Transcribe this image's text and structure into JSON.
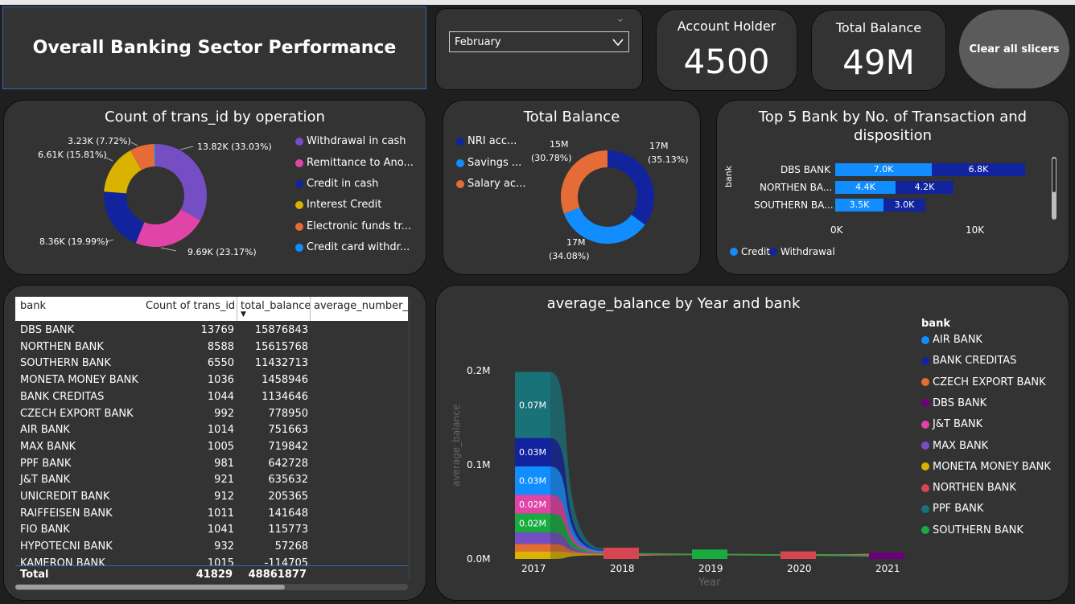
{
  "header": {
    "title": "Overall Banking Sector Performance"
  },
  "slicer": {
    "value": "February"
  },
  "kpi": {
    "account_holder_label": "Account Holder",
    "account_holder_value": "4500",
    "total_balance_label": "Total Balance",
    "total_balance_value": "49M"
  },
  "clear_button": {
    "label": "Clear all slicers"
  },
  "colors": {
    "panel": "#333333",
    "blue": "#118dff",
    "navy": "#12239e",
    "orange": "#e66c37",
    "purple": "#744ec2",
    "pink": "#e044a7",
    "yellow": "#d9b300",
    "teal": "#197278",
    "dark_purple": "#6b007b",
    "red": "#d64550",
    "green": "#1aab40"
  },
  "donut_operation": {
    "title": "Count of trans_id by operation",
    "legend": [
      "Withdrawal in cash",
      "Remittance to Ano...",
      "Credit in cash",
      "Interest Credit",
      "Electronic funds tr...",
      "Credit card withdr..."
    ],
    "labels": {
      "withdrawal": "13.82K (33.03%)",
      "remittance": "9.69K (23.17%)",
      "credit_cash": "8.36K (19.99%)",
      "interest": "6.61K (15.81%)",
      "electronic": "3.23K (7.72%)"
    }
  },
  "donut_balance": {
    "title": "Total Balance",
    "legend": [
      "NRI acc...",
      "Savings ...",
      "Salary ac..."
    ],
    "labels": {
      "nri_value": "17M",
      "nri_pct": "(35.13%)",
      "savings_value": "17M",
      "savings_pct": "(34.08%)",
      "salary_value": "15M",
      "salary_pct": "(30.78%)"
    }
  },
  "top5": {
    "title_line1": "Top 5 Bank by No. of Transaction and",
    "title_line2": "disposition",
    "axis_label": "bank",
    "banks": [
      "DBS BANK",
      "NORTHEN BA...",
      "SOUTHERN BA..."
    ],
    "credit_labels": [
      "7.0K",
      "4.4K",
      "3.5K"
    ],
    "withdrawal_labels": [
      "6.8K",
      "4.2K",
      "3.0K"
    ],
    "ticks": [
      "0K",
      "10K"
    ],
    "legend": [
      "Credit",
      "Withdrawal"
    ]
  },
  "table": {
    "headers": [
      "bank",
      "Count of trans_id",
      "total_balance",
      "average_number_o"
    ],
    "rows": [
      [
        "DBS BANK",
        "13769",
        "15876843"
      ],
      [
        "NORTHEN BANK",
        "8588",
        "15615768"
      ],
      [
        "SOUTHERN BANK",
        "6550",
        "11432713"
      ],
      [
        "MONETA MONEY BANK",
        "1036",
        "1458946"
      ],
      [
        "BANK CREDITAS",
        "1044",
        "1134646"
      ],
      [
        "CZECH EXPORT BANK",
        "992",
        "778950"
      ],
      [
        "AIR BANK",
        "1014",
        "751663"
      ],
      [
        "MAX BANK",
        "1005",
        "719842"
      ],
      [
        "PPF BANK",
        "981",
        "642728"
      ],
      [
        "J&T BANK",
        "921",
        "635632"
      ],
      [
        "UNICREDIT BANK",
        "912",
        "205365"
      ],
      [
        "RAIFFEISEN BANK",
        "1011",
        "141648"
      ],
      [
        "FIO BANK",
        "1041",
        "115773"
      ],
      [
        "HYPOTECNI BANK",
        "932",
        "57268"
      ],
      [
        "KAMERON BANK",
        "1015",
        "-114705"
      ]
    ],
    "total": [
      "Total",
      "41829",
      "48861877"
    ]
  },
  "ribbon": {
    "title": "average_balance by Year and bank",
    "xlabel": "Year",
    "ylabel": "average_balance",
    "yticks": [
      "0.2M",
      "0.1M",
      "0.0M"
    ],
    "years": [
      "2017",
      "2018",
      "2019",
      "2020",
      "2021"
    ],
    "legend_title": "bank",
    "legend": [
      "AIR BANK",
      "BANK CREDITAS",
      "CZECH EXPORT BANK",
      "DBS BANK",
      "J&T BANK",
      "MAX BANK",
      "MONETA MONEY BANK",
      "NORTHEN BANK",
      "PPF BANK",
      "SOUTHERN BANK"
    ],
    "segment_labels": [
      "0.07M",
      "0.03M",
      "0.03M",
      "0.02M",
      "0.02M"
    ]
  },
  "chart_data": [
    {
      "type": "pie",
      "title": "Count of trans_id by operation",
      "categories": [
        "Withdrawal in cash",
        "Remittance to Ano...",
        "Credit in cash",
        "Interest Credit",
        "Electronic funds tr...",
        "Credit card withdr..."
      ],
      "values": [
        13820,
        9690,
        8360,
        6610,
        3230,
        130
      ]
    },
    {
      "type": "pie",
      "title": "Total Balance",
      "categories": [
        "NRI acc...",
        "Savings ...",
        "Salary ac..."
      ],
      "values": [
        35.13,
        34.08,
        30.78
      ]
    },
    {
      "type": "bar",
      "title": "Top 5 Bank by No. of Transaction and disposition",
      "categories": [
        "DBS BANK",
        "NORTHEN BA...",
        "SOUTHERN BA..."
      ],
      "series": [
        {
          "name": "Credit",
          "values": [
            7000,
            4400,
            3500
          ]
        },
        {
          "name": "Withdrawal",
          "values": [
            6800,
            4200,
            3000
          ]
        }
      ],
      "xlim": [
        0,
        14000
      ]
    },
    {
      "type": "area",
      "title": "average_balance by Year and bank",
      "xlabel": "Year",
      "ylabel": "average_balance",
      "x": [
        "2017",
        "2018",
        "2019",
        "2020",
        "2021"
      ],
      "ylim": [
        0,
        200000
      ],
      "series_2017": [
        {
          "name": "MONETA MONEY BANK",
          "value": 8000
        },
        {
          "name": "CZECH EXPORT BANK",
          "value": 8000
        },
        {
          "name": "MAX BANK",
          "value": 12000
        },
        {
          "name": "SOUTHERN BANK",
          "value": 20000
        },
        {
          "name": "J&T BANK",
          "value": 20000
        },
        {
          "name": "AIR BANK",
          "value": 30000
        },
        {
          "name": "BANK CREDITAS",
          "value": 30000
        },
        {
          "name": "PPF BANK",
          "value": 70000
        }
      ],
      "later_years_highlight": [
        {
          "year": "2018",
          "name": "NORTHEN BANK",
          "value": 12000
        },
        {
          "year": "2019",
          "name": "SOUTHERN BANK",
          "value": 10000
        },
        {
          "year": "2020",
          "name": "NORTHEN BANK",
          "value": 8000
        },
        {
          "year": "2021",
          "name": "DBS BANK",
          "value": 7000
        }
      ]
    }
  ]
}
